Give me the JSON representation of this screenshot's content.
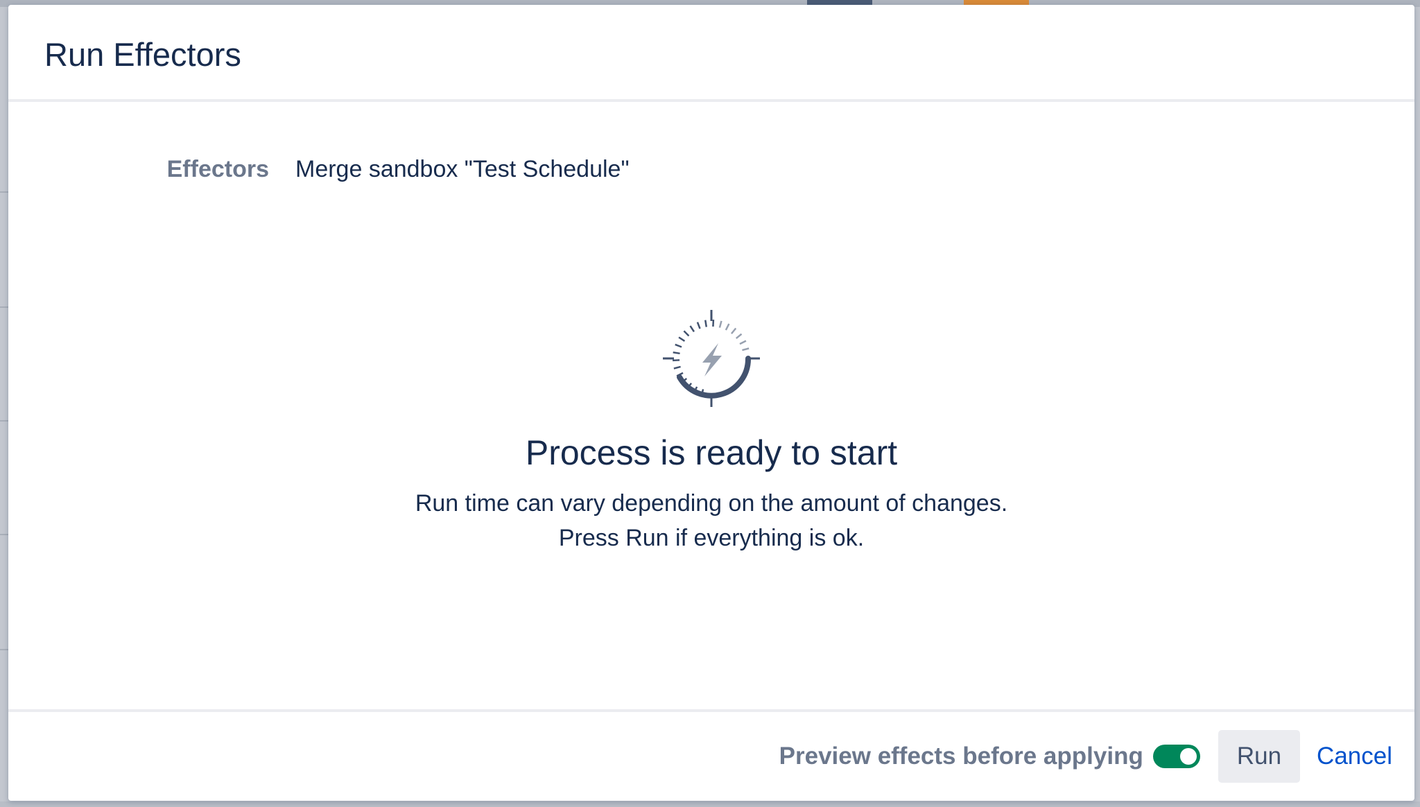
{
  "dialog": {
    "title": "Run Effectors",
    "field": {
      "label": "Effectors",
      "value": "Merge sandbox \"Test Schedule\""
    },
    "status": {
      "icon": "timer-lightning-icon",
      "title": "Process is ready to start",
      "lines": [
        "Run time can vary depending on the amount of changes.",
        "Press Run if everything is ok."
      ]
    },
    "footer": {
      "preview_label": "Preview effects before applying",
      "preview_enabled": true,
      "run_label": "Run",
      "cancel_label": "Cancel"
    }
  },
  "colors": {
    "title_text": "#172b4d",
    "muted_text": "#6b778c",
    "toggle_on": "#00875a",
    "link": "#0052cc",
    "button_bg": "#ebecf0",
    "icon_dark": "#42526e",
    "icon_light": "#97a0af"
  }
}
